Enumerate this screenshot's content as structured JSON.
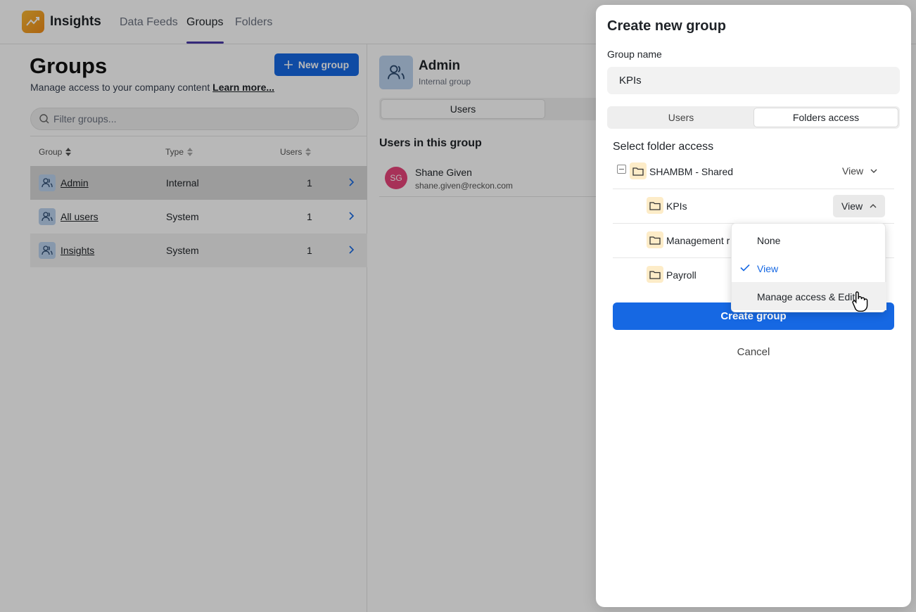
{
  "app": {
    "title": "Insights",
    "nav": [
      "Data Feeds",
      "Groups",
      "Folders"
    ],
    "active_nav": "Groups"
  },
  "groups_page": {
    "title": "Groups",
    "subtitle": "Manage access to your company content",
    "learn_more": "Learn more...",
    "new_group_label": "New group",
    "filter_placeholder": "Filter groups...",
    "columns": [
      "Group",
      "Type",
      "Users"
    ],
    "rows": [
      {
        "name": "Admin",
        "type": "Internal",
        "users": "1"
      },
      {
        "name": "All users",
        "type": "System",
        "users": "1"
      },
      {
        "name": "Insights",
        "type": "System",
        "users": "1"
      }
    ]
  },
  "detail": {
    "name": "Admin",
    "kind": "Internal group",
    "tab_users": "Users",
    "section_title": "Users in this group",
    "user": {
      "initials": "SG",
      "name": "Shane Given",
      "email": "shane.given@reckon.com"
    }
  },
  "panel": {
    "title": "Create new group",
    "group_name_label": "Group name",
    "group_name_value": "KPIs",
    "tabs": [
      "Users",
      "Folders access"
    ],
    "active_tab": "Folders access",
    "section_title": "Select folder access",
    "folders": [
      {
        "name": "SHAMBM - Shared",
        "permission": "View"
      },
      {
        "name": "KPIs",
        "permission": "View"
      },
      {
        "name": "Management r",
        "permission": ""
      },
      {
        "name": "Payroll",
        "permission": ""
      }
    ],
    "create_label": "Create group",
    "cancel_label": "Cancel"
  },
  "dropdown": {
    "options": [
      "None",
      "View",
      "Manage access & Edit"
    ],
    "selected": "View"
  },
  "colors": {
    "accent": "#1668e3",
    "nav_underline": "#4a3aa8",
    "avatar": "#e8447a",
    "folder_bg": "#fdecc8"
  }
}
